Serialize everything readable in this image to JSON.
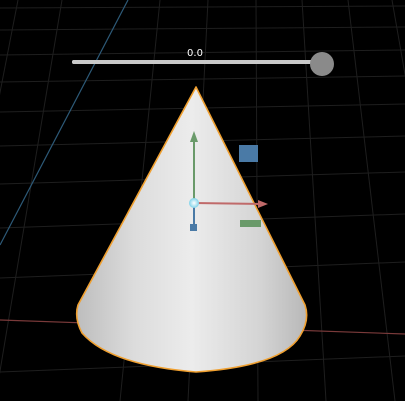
{
  "slider": {
    "value_label": "0.0",
    "fraction": 1.0
  },
  "colors": {
    "background": "#000000",
    "grid_line": "#1e1e1e",
    "axis_x": "#7a3a3a",
    "axis_z": "#2d5a78",
    "cone_outline": "#f0a030",
    "gizmo_x": "#c06a6a",
    "gizmo_y": "#6a9a6a",
    "gizmo_z": "#4a7aa6",
    "gizmo_center": "#8fdcef",
    "slider_track": "#c9c9c9",
    "slider_handle": "#8a8a8a"
  },
  "scene": {
    "object": "cone",
    "selected": true,
    "gizmo": "translate"
  }
}
